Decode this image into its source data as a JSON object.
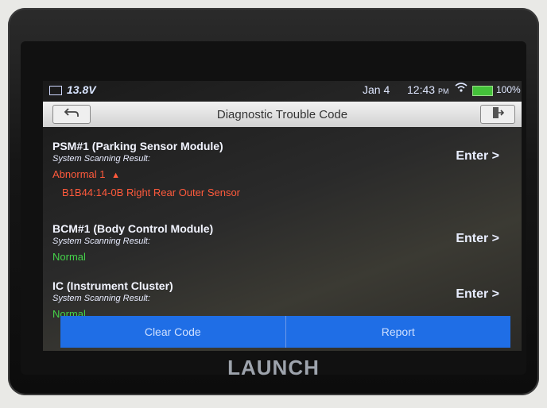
{
  "status_bar": {
    "voltage": "13.8",
    "voltage_unit": "V",
    "date": "Jan 4",
    "time": "12:43",
    "ampm": "PM",
    "battery": "100%"
  },
  "header": {
    "title": "Diagnostic Trouble Code"
  },
  "modules": [
    {
      "name": "PSM#1 (Parking Sensor Module)",
      "result_label": "System Scanning Result:",
      "status": "Abnormal 1",
      "dtc": "B1B44:14-0B Right Rear Outer Sensor",
      "enter_label": "Enter >"
    },
    {
      "name": "BCM#1 (Body Control Module)",
      "result_label": "System Scanning Result:",
      "status": "Normal",
      "enter_label": "Enter >"
    },
    {
      "name": "IC (Instrument Cluster)",
      "result_label": "System Scanning Result:",
      "status": "Normal",
      "enter_label": "Enter >"
    }
  ],
  "actions": {
    "clear_code": "Clear Code",
    "report": "Report"
  },
  "brand": "LAUNCH",
  "colors": {
    "accent_blue": "#1f6ee6",
    "abnormal": "#ff5a3c",
    "normal": "#45d24a"
  }
}
